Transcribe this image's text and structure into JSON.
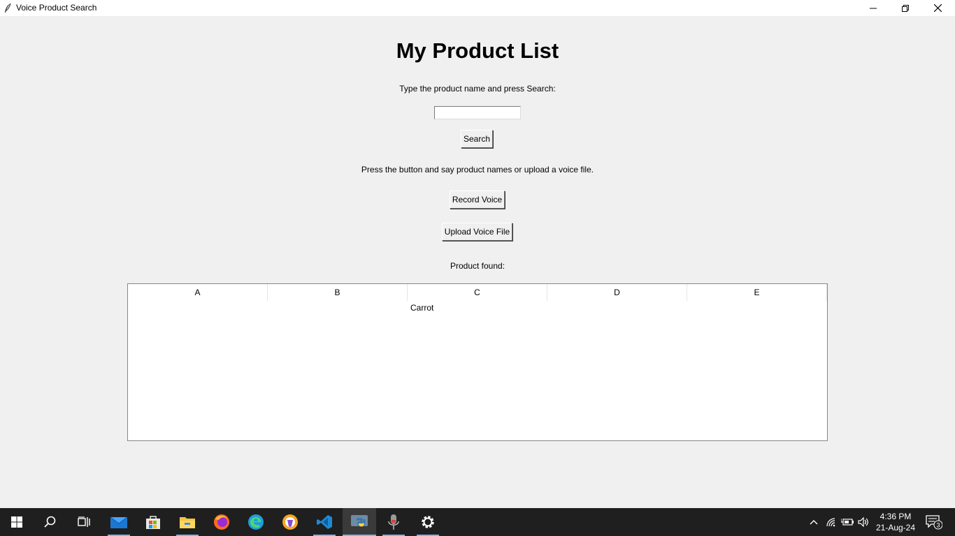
{
  "window": {
    "title": "Voice Product Search"
  },
  "main": {
    "heading": "My Product List",
    "search_instruction": "Type the product name and press Search:",
    "search_value": "",
    "search_button": "Search",
    "voice_instruction": "Press the button and say product names or upload a voice file.",
    "record_button": "Record Voice",
    "upload_button": "Upload Voice File",
    "result_label": "Product found:"
  },
  "table": {
    "columns": [
      "A",
      "B",
      "C",
      "D",
      "E"
    ],
    "rows": [
      {
        "C": "Carrot"
      }
    ]
  },
  "taskbar": {
    "items": [
      "start-icon",
      "search-icon",
      "task-view-icon",
      "mail-icon",
      "store-icon",
      "file-explorer-icon",
      "firefox-icon",
      "edge-icon",
      "brave-icon",
      "vscode-icon",
      "python-icon",
      "microphone-icon",
      "settings-icon"
    ],
    "tray_icons": [
      "chevron-up-icon",
      "wifi-icon",
      "battery-icon",
      "volume-icon"
    ],
    "time": "4:36 PM",
    "date": "21-Aug-24",
    "notification_count": "3"
  },
  "colors": {
    "taskbar_bg": "#1f1f1f",
    "window_bg": "#f0f0f0",
    "accent": "#76b9ed"
  }
}
